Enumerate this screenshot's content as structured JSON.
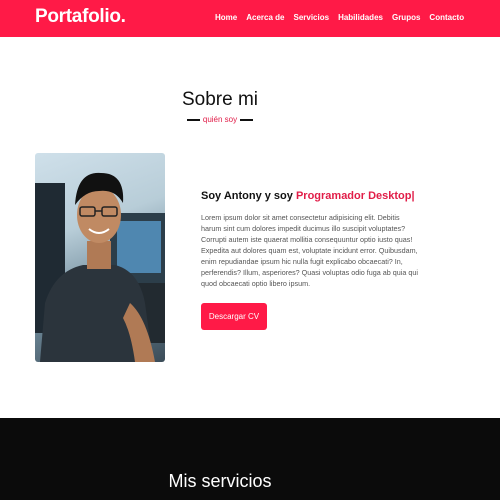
{
  "nav": {
    "logo": "Portafolio.",
    "items": [
      "Home",
      "Acerca de",
      "Servicios",
      "Habilidades",
      "Grupos",
      "Contacto"
    ]
  },
  "about": {
    "title": "Sobre mi",
    "subtitle": "quién soy",
    "intro_prefix": "Soy Antony y soy ",
    "intro_role": "Programador Desktop|",
    "description": "Lorem ipsum dolor sit amet consectetur adipisicing elit. Debitis harum sint cum dolores impedit ducimus illo suscipit voluptates? Corrupti autem iste quaerat mollitia consequuntur optio iusto quas! Expedita aut dolores quam est, voluptate incidunt error. Quibusdam, enim repudiandae ipsum hic nulla fugit explicabo obcaecati? In, perferendis? Illum, asperiores? Quasi voluptas odio fuga ab quia qui quod obcaecati optio libero ipsum.",
    "cv_button": "Descargar CV"
  },
  "services": {
    "title": "Mis servicios"
  },
  "colors": {
    "accent": "#ff1a47",
    "dark_section": "#0b0b0b"
  }
}
